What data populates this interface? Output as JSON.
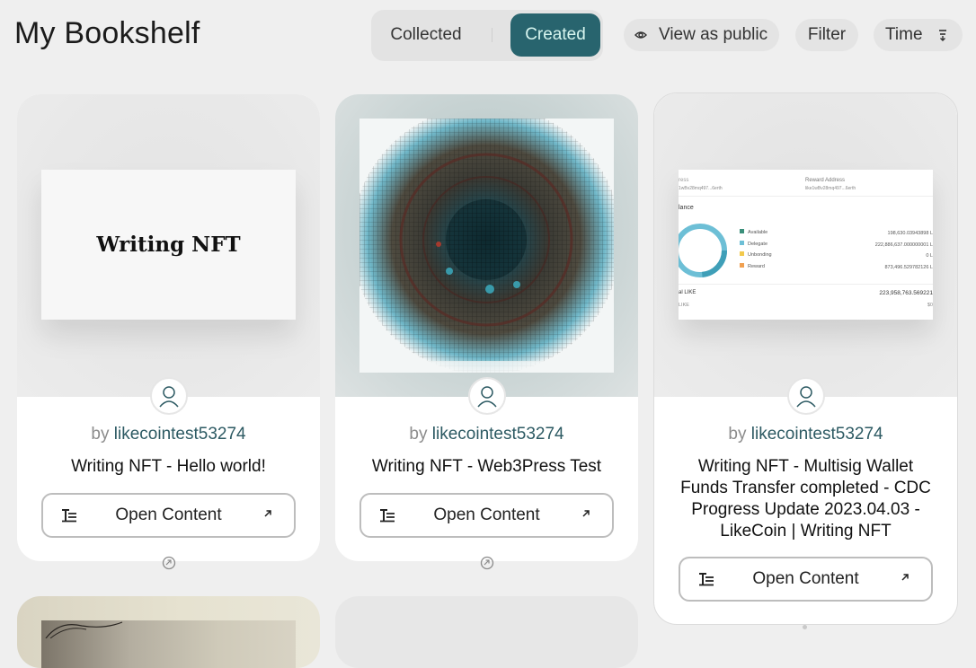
{
  "header": {
    "title": "My Bookshelf",
    "tabs": {
      "collected": "Collected",
      "created": "Created",
      "active": "created"
    },
    "view_public": "View as public",
    "filter": "Filter",
    "time": "Time"
  },
  "colors": {
    "accent": "#28646e",
    "accent_text": "#d7f5ef",
    "author": "#2d5a63"
  },
  "cards": [
    {
      "by": "by",
      "author": "likecointest53274",
      "title": "Writing NFT - Hello world!",
      "cover_text": "Writing NFT",
      "button": "Open Content"
    },
    {
      "by": "by",
      "author": "likecointest53274",
      "title": "Writing NFT - Web3Press Test",
      "button": "Open Content"
    },
    {
      "by": "by",
      "author": "likecointest53274",
      "title_lines": [
        "Writing NFT - Multisig Wallet",
        "Funds Transfer completed - CDC",
        "Progress Update 2023.04.03 -",
        "LikeCoin | Writing NFT"
      ],
      "button": "Open Content",
      "preview": {
        "col1": "ress",
        "col2": "Reward Address",
        "addr1": "1wBv28mq497...6erth",
        "addr2": "like1wBv28mq497...6erth",
        "balance": "lance",
        "legend": [
          "Available",
          "Delegate",
          "Unbonding",
          "Reward"
        ],
        "amounts": [
          "198,630.03943898 L",
          "222,886,637.000000001 L",
          "0 L",
          "873,496.529782126 L"
        ],
        "total_label": "al LIKE",
        "total_value": "223,958,763.569221",
        "sub_label": "LIKE",
        "sub_value": "$0"
      }
    }
  ]
}
